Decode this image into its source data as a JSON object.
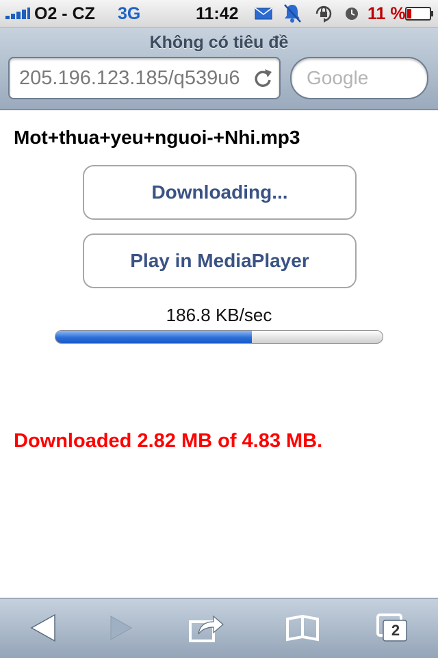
{
  "status_bar": {
    "carrier": "O2 - CZ",
    "network": "3G",
    "time": "11:42",
    "battery": "11 %",
    "icons": [
      "signal-bars-icon",
      "mail-icon",
      "mute-bell-icon",
      "rotation-lock-icon",
      "alarm-icon",
      "battery-icon"
    ],
    "battery_color": "#c00000"
  },
  "browser": {
    "page_title": "Không có tiêu đề",
    "url": "205.196.123.185/q539u6",
    "search_placeholder": "Google"
  },
  "download": {
    "filename": "Mot+thua+yeu+nguoi-+Nhi.mp3",
    "download_button": "Downloading...",
    "play_button": "Play in MediaPlayer",
    "speed": "186.8 KB/sec",
    "progress": 0.6,
    "status": "Downloaded 2.82 MB of 4.83 MB.",
    "status_color": "#ff0000"
  },
  "toolbar": {
    "icons": [
      "back-arrow-icon",
      "forward-arrow-icon",
      "share-icon",
      "bookmarks-icon",
      "pages-icon"
    ],
    "pages_count": "2"
  }
}
